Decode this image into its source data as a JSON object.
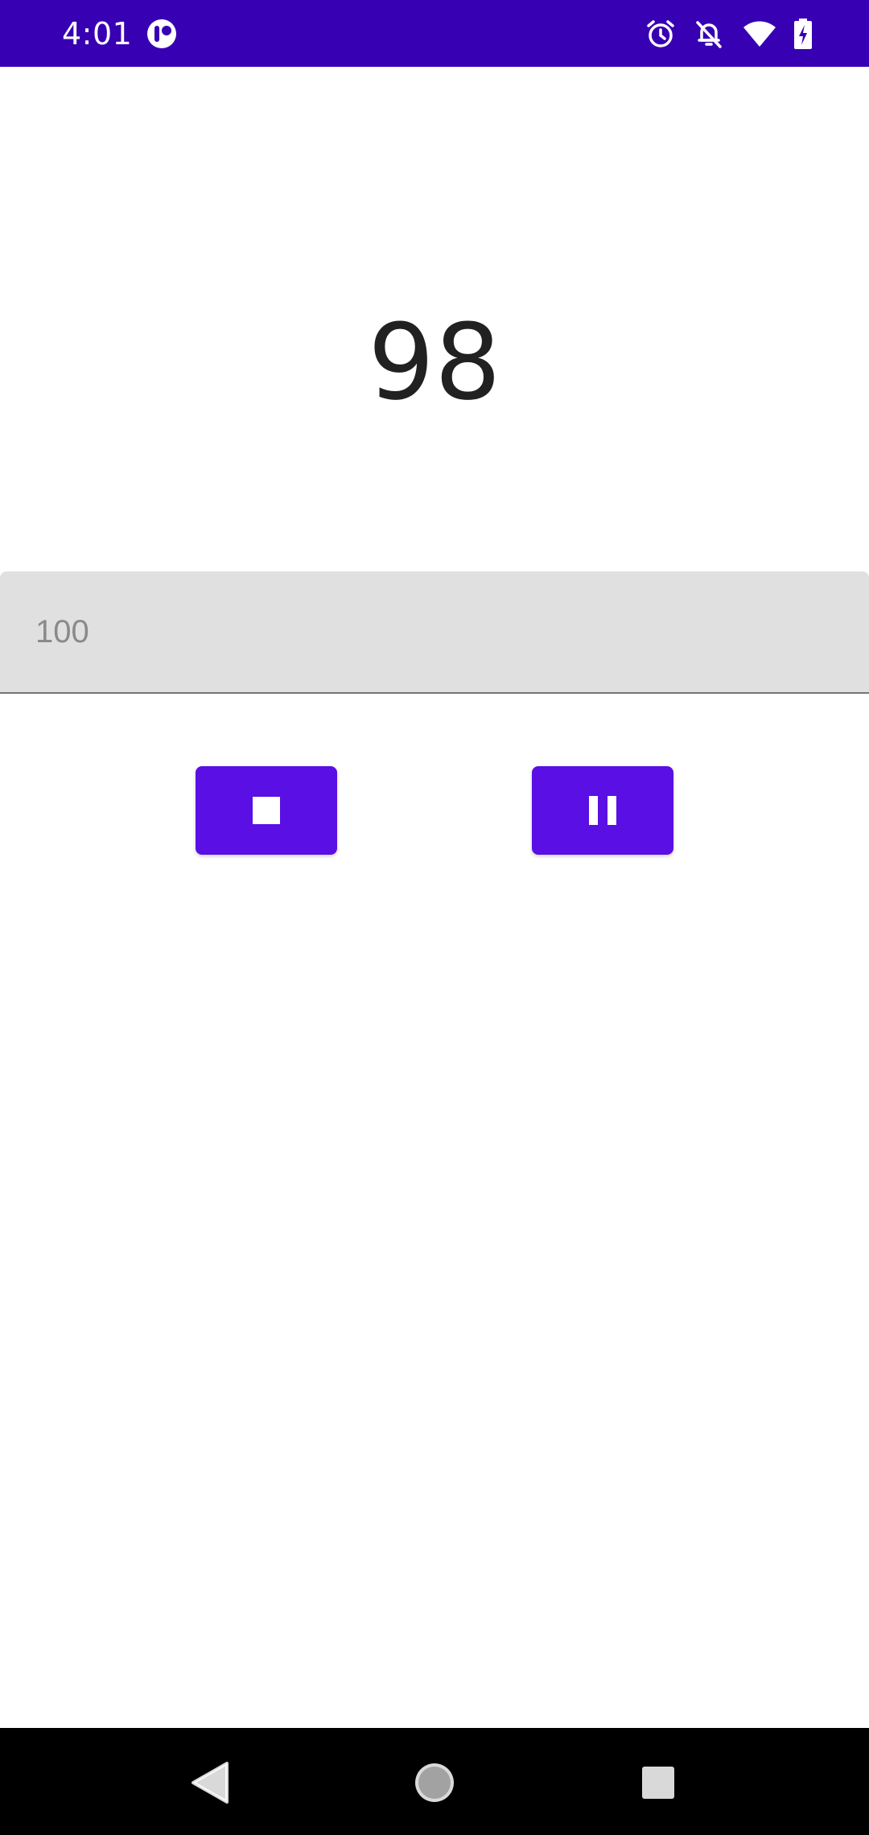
{
  "status_bar": {
    "time": "4:01",
    "background_color": "#3700B3",
    "icons": [
      "app-notification-icon",
      "alarm-icon",
      "notifications-off-icon",
      "wifi-icon",
      "battery-charging-icon"
    ]
  },
  "counter": {
    "value": "98"
  },
  "input": {
    "value": "",
    "placeholder": "100"
  },
  "buttons": {
    "stop_icon": "stop-icon",
    "pause_icon": "pause-icon",
    "color": "#5A0FE4"
  },
  "nav_bar": {
    "items": [
      "back-icon",
      "home-icon",
      "recents-icon"
    ]
  }
}
